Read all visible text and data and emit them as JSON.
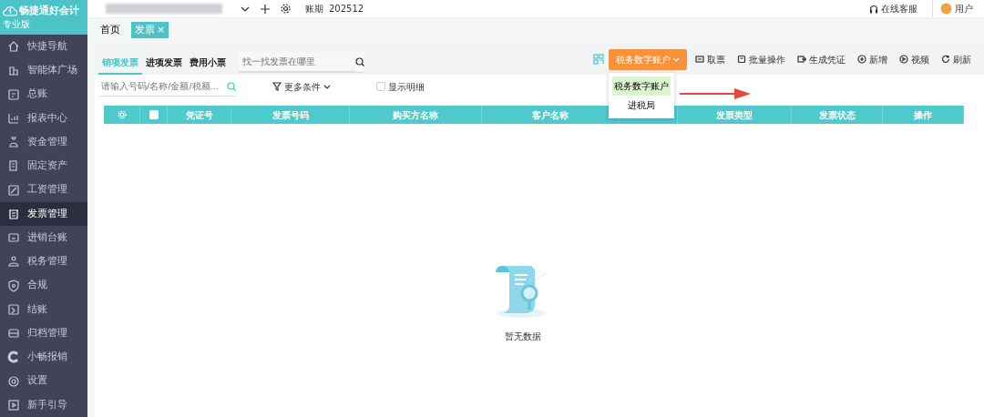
{
  "app": {
    "logo": "畅捷通好会计",
    "edition": "专业版"
  },
  "sidebar": {
    "items": [
      {
        "label": "快捷导航",
        "selected": false
      },
      {
        "label": "智能体广场",
        "selected": false
      },
      {
        "label": "总账",
        "selected": false
      },
      {
        "label": "报表中心",
        "selected": false
      },
      {
        "label": "资金管理",
        "selected": false
      },
      {
        "label": "固定资产",
        "selected": false
      },
      {
        "label": "工资管理",
        "selected": false
      },
      {
        "label": "发票管理",
        "selected": true
      },
      {
        "label": "进销台账",
        "selected": false
      },
      {
        "label": "税务管理",
        "selected": false
      },
      {
        "label": "合规",
        "selected": false
      },
      {
        "label": "结账",
        "selected": false
      },
      {
        "label": "归档管理",
        "selected": false
      },
      {
        "label": "小畅报销",
        "selected": false
      },
      {
        "label": "设置",
        "selected": false
      },
      {
        "label": "新手引导",
        "selected": false
      }
    ]
  },
  "topbar": {
    "period_label": "账期",
    "period": "202512",
    "support": "在线客服",
    "user": "用户"
  },
  "page_tabs": [
    {
      "label": "首页",
      "selected": false
    },
    {
      "label": "发票",
      "selected": true,
      "close": "×"
    }
  ],
  "invoice_tabs": [
    {
      "label": "销项发票",
      "selected": true
    },
    {
      "label": "进项发票",
      "selected": false
    },
    {
      "label": "费用小票",
      "selected": false
    }
  ],
  "tab_search": {
    "placeholder": "找一找发票在哪里"
  },
  "toolbar": {
    "account_button": "税务数字账户",
    "actions": [
      "取票",
      "批量操作",
      "生成凭证",
      "新增",
      "视频",
      "刷新"
    ]
  },
  "dropdown": [
    {
      "label": "税务数字账户",
      "selected": true
    },
    {
      "label": "进税局",
      "selected": false
    }
  ],
  "filter": {
    "placeholder": "请输入号码/名称/金额/税额...",
    "more": "更多条件",
    "detail": {
      "label": "显示明细",
      "checked": false
    }
  },
  "table": {
    "columns": [
      {
        "kind": "gear"
      },
      {
        "kind": "checkbox",
        "checked": false
      },
      {
        "kind": "text",
        "label": "凭证号"
      },
      {
        "kind": "text",
        "label": "发票号码"
      },
      {
        "kind": "text",
        "label": "购买方名称"
      },
      {
        "kind": "text",
        "label": "客户名称"
      },
      {
        "kind": "blank"
      },
      {
        "kind": "text",
        "label": "发票类型"
      },
      {
        "kind": "text",
        "label": "发票状态"
      },
      {
        "kind": "text",
        "label": "操作"
      }
    ]
  },
  "empty": {
    "text": "暂无数据"
  }
}
